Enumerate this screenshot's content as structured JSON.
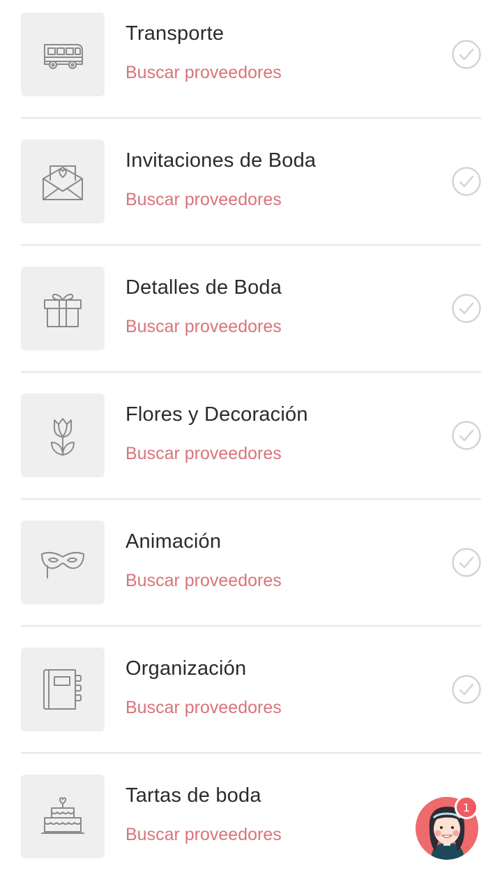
{
  "categories": [
    {
      "title": "Transporte",
      "link": "Buscar proveedores",
      "icon": "bus-icon"
    },
    {
      "title": "Invitaciones de Boda",
      "link": "Buscar proveedores",
      "icon": "envelope-heart-icon"
    },
    {
      "title": "Detalles de Boda",
      "link": "Buscar proveedores",
      "icon": "gift-icon"
    },
    {
      "title": "Flores y Decoración",
      "link": "Buscar proveedores",
      "icon": "tulip-icon"
    },
    {
      "title": "Animación",
      "link": "Buscar proveedores",
      "icon": "mask-icon"
    },
    {
      "title": "Organización",
      "link": "Buscar proveedores",
      "icon": "planner-icon"
    },
    {
      "title": "Tartas de boda",
      "link": "Buscar proveedores",
      "icon": "cake-icon"
    }
  ],
  "assistant": {
    "badge_count": "1",
    "icon": "assistant-avatar-icon"
  },
  "colors": {
    "title": "#2b2b2b",
    "link": "#d9747a",
    "thumb_bg": "#efefef",
    "check": "#d4d4d4",
    "badge": "#ef5b61",
    "assistant_bg": "#ee6a6c"
  }
}
